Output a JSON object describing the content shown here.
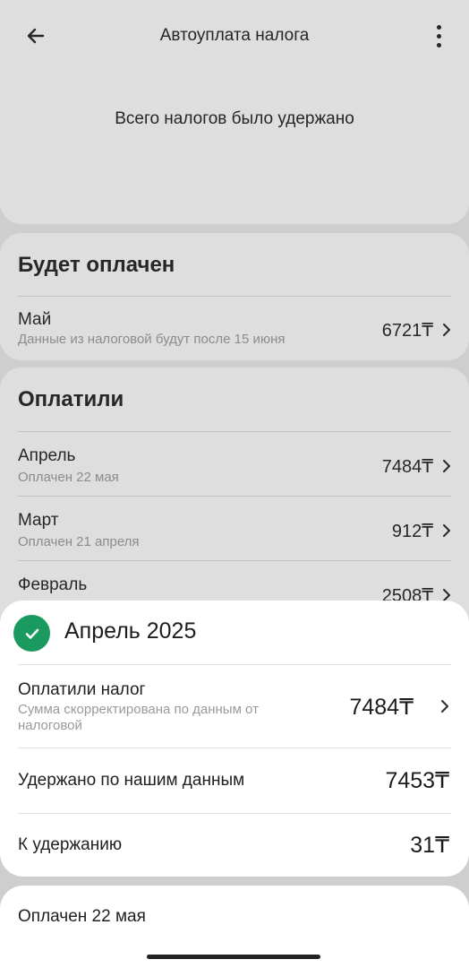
{
  "appbar": {
    "title": "Автоуплата налога"
  },
  "summary": {
    "label": "Всего налогов было удержано"
  },
  "will_be_paid": {
    "heading": "Будет оплачен",
    "items": [
      {
        "month": "Май",
        "note": "Данные из налоговой будут после 15 июня",
        "amount": "6721₸"
      }
    ]
  },
  "paid": {
    "heading": "Оплатили",
    "items": [
      {
        "month": "Апрель",
        "note": "Оплачен 22 мая",
        "amount": "7484₸"
      },
      {
        "month": "Март",
        "note": "Оплачен 21 апреля",
        "amount": "912₸"
      },
      {
        "month": "Февраль",
        "note": "",
        "amount": "2508₸"
      }
    ]
  },
  "sheet": {
    "title": "Апрель 2025",
    "rows": [
      {
        "title": "Оплатили налог",
        "subtitle": "Сумма скорректирована по данным от налоговой",
        "amount": "7484₸"
      },
      {
        "title": "Удержано по нашим данным",
        "amount": "7453₸"
      },
      {
        "title": "К удержанию",
        "amount": "31₸"
      }
    ],
    "status": "Оплачен 22 мая"
  },
  "colors": {
    "accent_green": "#1b9a5f",
    "background": "#e3e3e3",
    "card": "#f4f4f4"
  },
  "icons": {
    "back": "arrow-left-icon",
    "more": "more-vertical-icon",
    "chevron": "chevron-right-icon",
    "check": "check-icon"
  }
}
